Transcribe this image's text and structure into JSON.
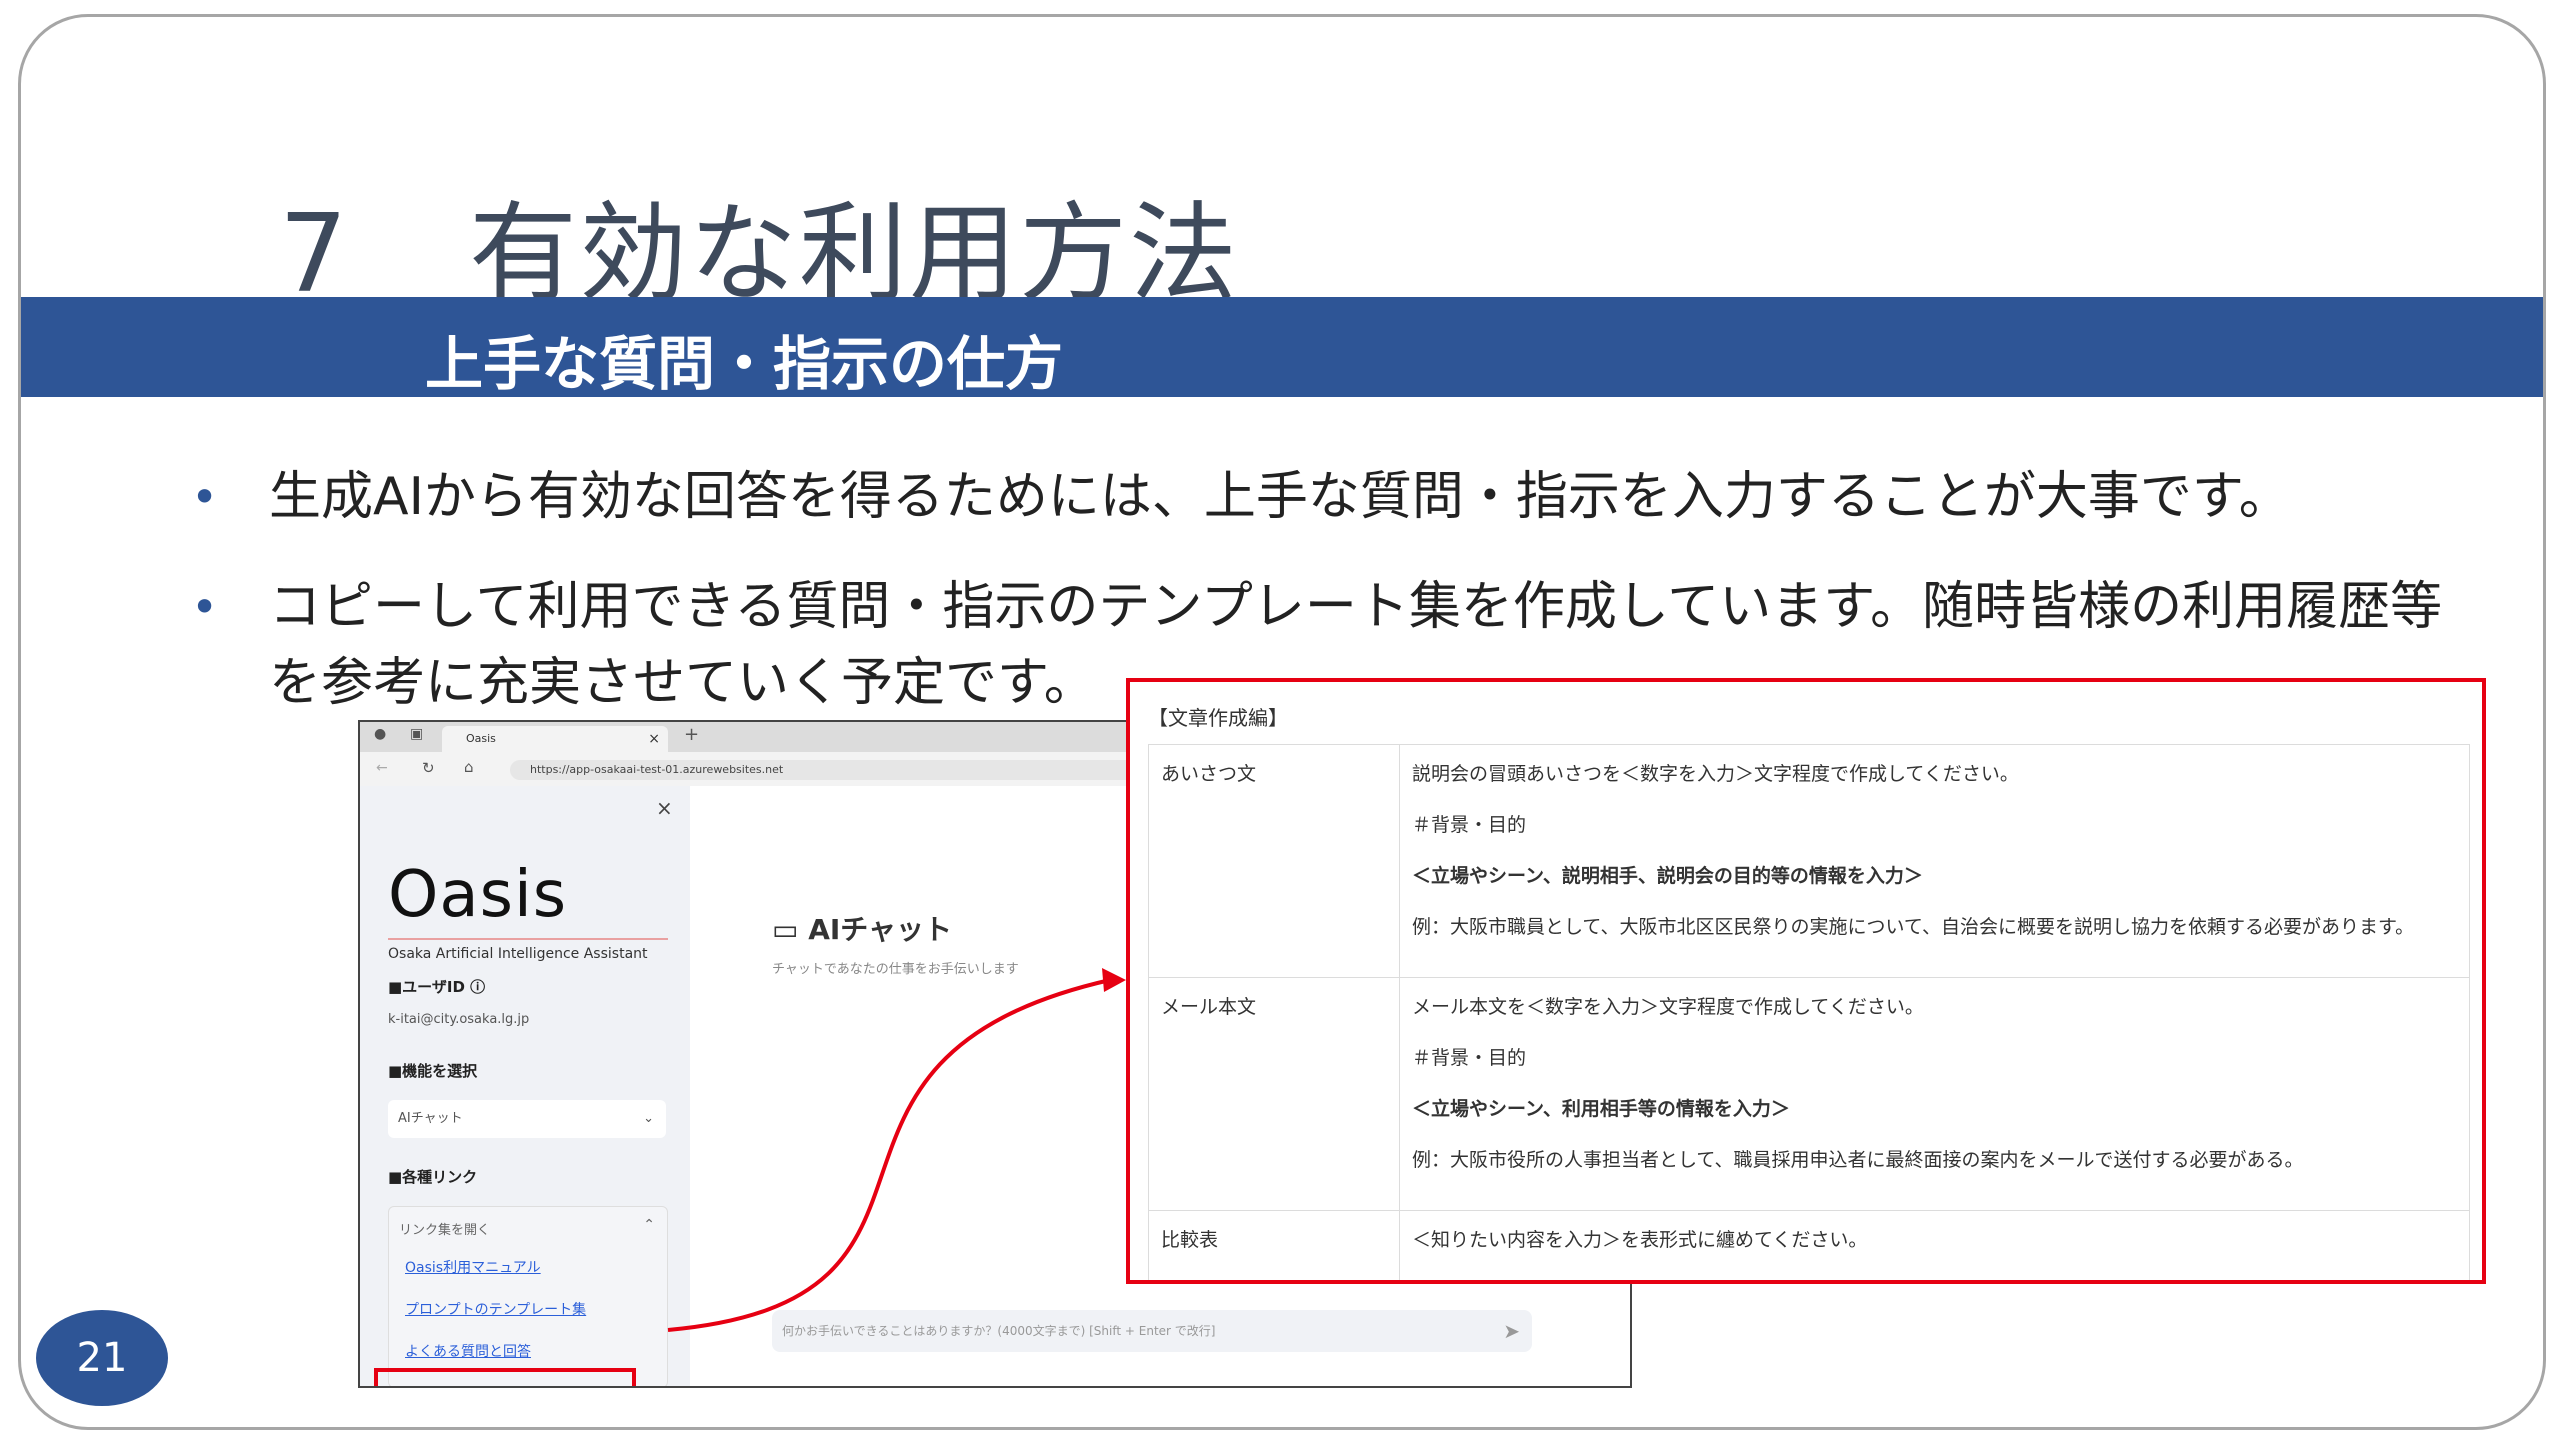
{
  "slide": {
    "title_number": "7",
    "title_text": "有効な利用方法",
    "subtitle": "上手な質問・指示の仕方",
    "bullets": [
      "生成AIから有効な回答を得るためには、上手な質問・指示を入力することが大事です。",
      "コピーして利用できる質問・指示のテンプレート集を作成しています。随時皆様の利用履歴等",
      "を参考に充実させていく予定です。"
    ],
    "page_number": "21",
    "bullet_glyph": "•"
  },
  "browser": {
    "tab_title": "Oasis",
    "tab_close": "×",
    "new_tab": "+",
    "url": "https://app-osakaai-test-01.azurewebsites.net"
  },
  "sidebar": {
    "close": "×",
    "logo": "Oasis",
    "logo_sub": "Osaka Artificial Intelligence Assistant",
    "user_label": "■ユーザID ⓘ",
    "user_value": "k-itai@city.osaka.lg.jp",
    "func_label": "■機能を選択",
    "func_select": "AIチャット",
    "links_label": "■各種リンク",
    "links_toggle": "リンク集を開く",
    "links": [
      "Oasis利用マニュアル",
      "プロンプトのテンプレート集",
      "よくある質問と回答"
    ]
  },
  "chat": {
    "title": "AIチャット",
    "subtitle": "チャットであなたの仕事をお手伝いします",
    "input_placeholder": "何かお手伝いできることはありますか？(4000文字まで) [Shift + Enter で改行]"
  },
  "template": {
    "title": "【文章作成編】",
    "rows": [
      {
        "key": "あいさつ文",
        "lines": [
          "説明会の冒頭あいさつを＜数字を入力＞文字程度で作成してください。",
          "＃背景・目的",
          "＜立場やシーン、説明相手、説明会の目的等の情報を入力＞",
          "例：大阪市職員として、大阪市北区区民祭りの実施について、自治会に概要を説明し協力を依頼する必要があります。"
        ]
      },
      {
        "key": "メール本文",
        "lines": [
          "メール本文を＜数字を入力＞文字程度で作成してください。",
          "＃背景・目的",
          "＜立場やシーン、利用相手等の情報を入力＞",
          "例：大阪市役所の人事担当者として、職員採用申込者に最終面接の案内をメールで送付する必要がある。"
        ]
      },
      {
        "key": "比較表",
        "lines": [
          "＜知りたい内容を入力＞を表形式に纏めてください。"
        ]
      }
    ]
  },
  "colors": {
    "band": "#2e5596",
    "highlight": "#e60012",
    "title": "#3e4a5c"
  }
}
